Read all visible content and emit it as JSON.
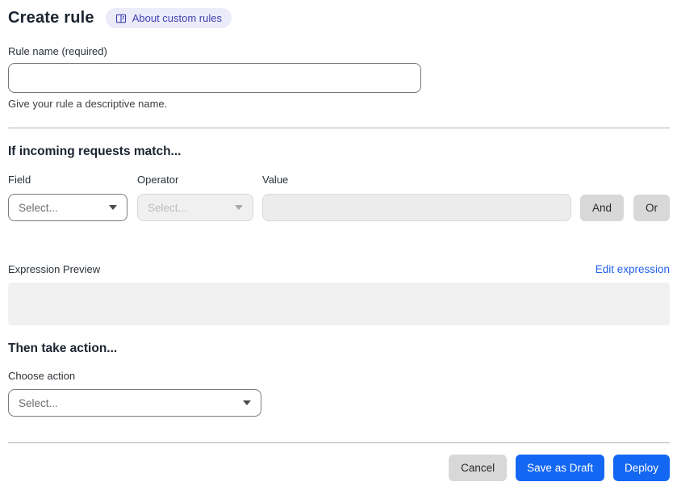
{
  "page": {
    "title": "Create rule",
    "badge_label": "About custom rules"
  },
  "rule_name": {
    "label": "Rule name (required)",
    "value": "",
    "helper": "Give your rule a descriptive name."
  },
  "match_section": {
    "heading": "If incoming requests match...",
    "field_label": "Field",
    "field_placeholder": "Select...",
    "operator_label": "Operator",
    "operator_placeholder": "Select...",
    "value_label": "Value",
    "value_value": "",
    "and_label": "And",
    "or_label": "Or",
    "expression_preview_label": "Expression Preview",
    "edit_expression_label": "Edit expression",
    "expression_value": ""
  },
  "action_section": {
    "heading": "Then take action...",
    "choose_action_label": "Choose action",
    "action_placeholder": "Select..."
  },
  "footer": {
    "cancel_label": "Cancel",
    "save_draft_label": "Save as Draft",
    "deploy_label": "Deploy"
  },
  "colors": {
    "primary_blue": "#1467f2",
    "link_blue": "#2161eb",
    "badge_bg": "#ecebfa",
    "badge_text": "#3f44b4",
    "divider": "#b3b3b3",
    "disabled_bg": "#f0f0f0",
    "expression_box_bg": "#f1f1f1",
    "gray_button_bg": "#d8d8d8"
  }
}
